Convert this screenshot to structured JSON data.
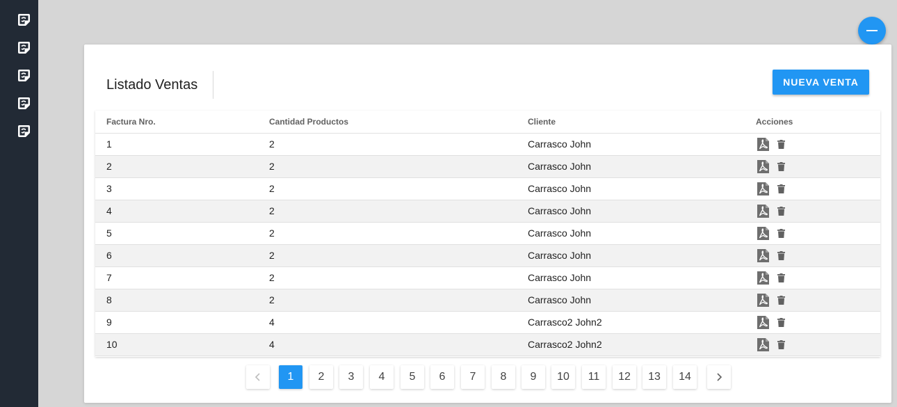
{
  "sidebar": {
    "icons": [
      "sticky-note-icon",
      "sticky-note-icon",
      "sticky-note-icon",
      "sticky-note-icon",
      "sticky-note-icon"
    ]
  },
  "fab": {
    "icon": "minus-icon"
  },
  "page": {
    "title": "Listado Ventas",
    "new_button_label": "NUEVA VENTA"
  },
  "table": {
    "headers": [
      "Factura Nro.",
      "Cantidad Productos",
      "Cliente",
      "Acciones"
    ],
    "rows": [
      {
        "factura": "1",
        "cantidad": "2",
        "cliente": "Carrasco John"
      },
      {
        "factura": "2",
        "cantidad": "2",
        "cliente": "Carrasco John"
      },
      {
        "factura": "3",
        "cantidad": "2",
        "cliente": "Carrasco John"
      },
      {
        "factura": "4",
        "cantidad": "2",
        "cliente": "Carrasco John"
      },
      {
        "factura": "5",
        "cantidad": "2",
        "cliente": "Carrasco John"
      },
      {
        "factura": "6",
        "cantidad": "2",
        "cliente": "Carrasco John"
      },
      {
        "factura": "7",
        "cantidad": "2",
        "cliente": "Carrasco John"
      },
      {
        "factura": "8",
        "cantidad": "2",
        "cliente": "Carrasco John"
      },
      {
        "factura": "9",
        "cantidad": "4",
        "cliente": "Carrasco2 John2"
      },
      {
        "factura": "10",
        "cantidad": "4",
        "cliente": "Carrasco2 John2"
      }
    ],
    "action_icons": [
      "pdf-icon",
      "trash-icon"
    ]
  },
  "pagination": {
    "pages": [
      "1",
      "2",
      "3",
      "4",
      "5",
      "6",
      "7",
      "8",
      "9",
      "10",
      "11",
      "12",
      "13",
      "14"
    ],
    "current": "1",
    "prev_icon": "chevron-left-icon",
    "next_icon": "chevron-right-icon"
  },
  "colors": {
    "sidebar": "#222a35",
    "accent": "#2196f3",
    "background": "#d6d6d6"
  }
}
